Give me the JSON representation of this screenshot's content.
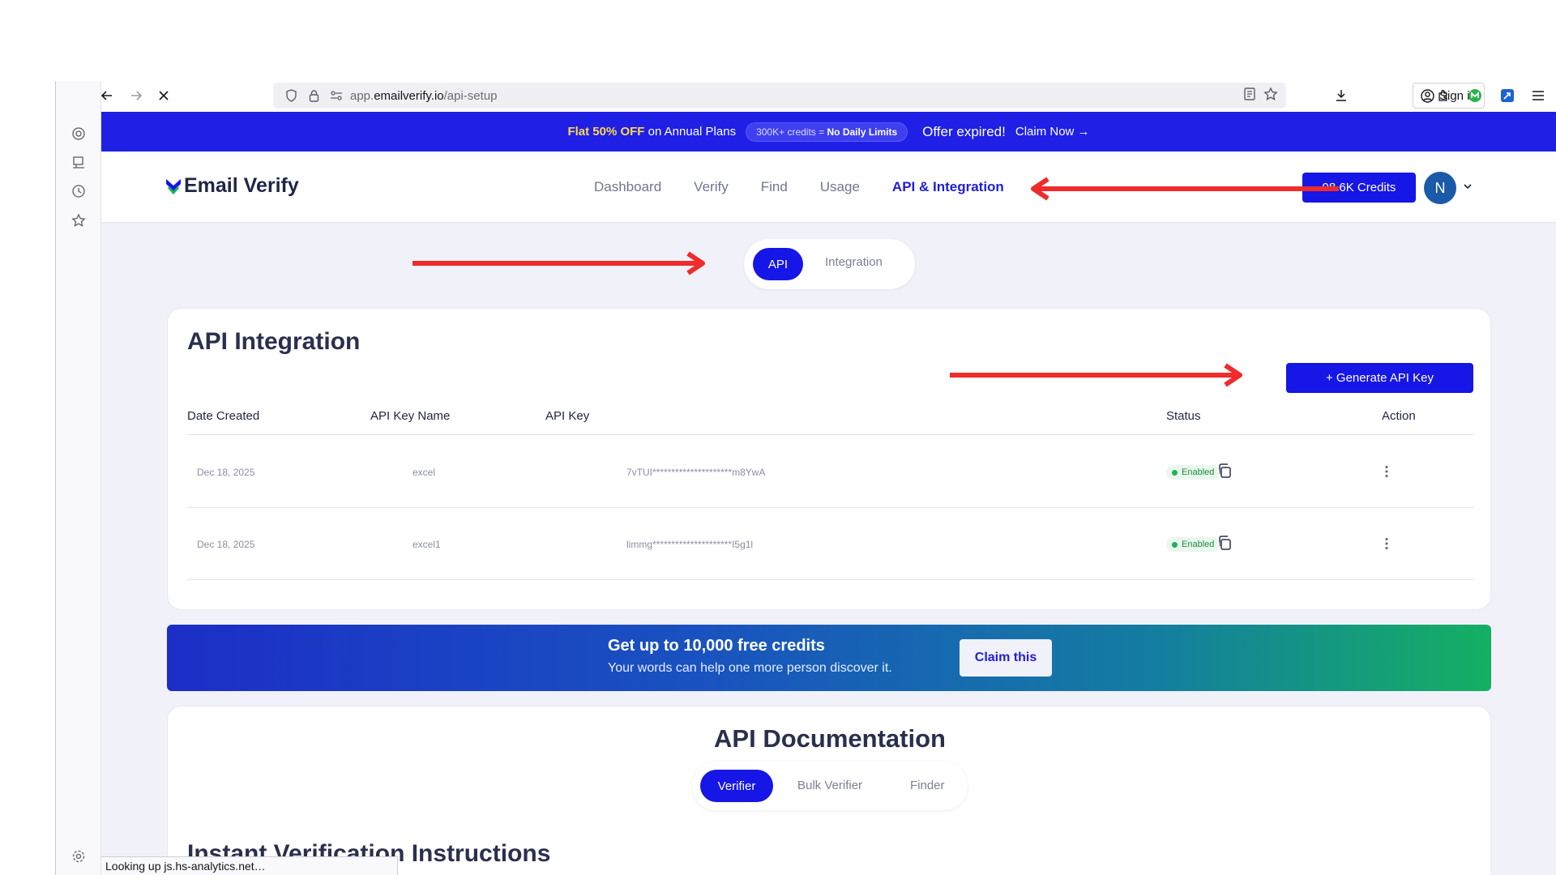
{
  "browser": {
    "url_prefix": "app.",
    "url_host": "emailverify.io",
    "url_path": "/api-setup",
    "sign_in_label": "Sign in",
    "status_text": "Looking up js.hs-analytics.net…"
  },
  "promo": {
    "highlight": "Flat 50% OFF",
    "rest": "on Annual Plans",
    "pill_text": "300K+ credits =",
    "pill_bold": "No Daily Limits",
    "expired": "Offer expired!",
    "claim": "Claim Now →"
  },
  "header": {
    "logo_text": "Email Verify",
    "nav": [
      "Dashboard",
      "Verify",
      "Find",
      "Usage",
      "API & Integration"
    ],
    "active_nav": "API & Integration",
    "credits": "98.6K Credits",
    "avatar_initial": "N"
  },
  "tabs": {
    "active": "API",
    "inactive": "Integration"
  },
  "api_card": {
    "title": "API Integration",
    "generate_label": "+ Generate API Key",
    "columns": [
      "Date Created",
      "API Key Name",
      "API Key",
      "Status",
      "Action"
    ],
    "rows": [
      {
        "date": "Dec 18, 2025",
        "name": "excel",
        "key": "7vTUI*********************m8YwA",
        "status": "Enabled"
      },
      {
        "date": "Dec 18, 2025",
        "name": "excel1",
        "key": "limmg*********************I5g1l",
        "status": "Enabled"
      }
    ]
  },
  "banner": {
    "heading": "Get up to 10,000 free credits",
    "sub": "Your words can help one more person discover it.",
    "button": "Claim this"
  },
  "docs": {
    "title": "API Documentation",
    "tabs": [
      "Verifier",
      "Bulk Verifier",
      "Finder"
    ],
    "instructions_title": "Instant Verification Instructions"
  },
  "colors": {
    "brand_blue": "#1616e6",
    "annotation_red": "#ef2b2b",
    "enabled_green": "#1fb14c"
  }
}
